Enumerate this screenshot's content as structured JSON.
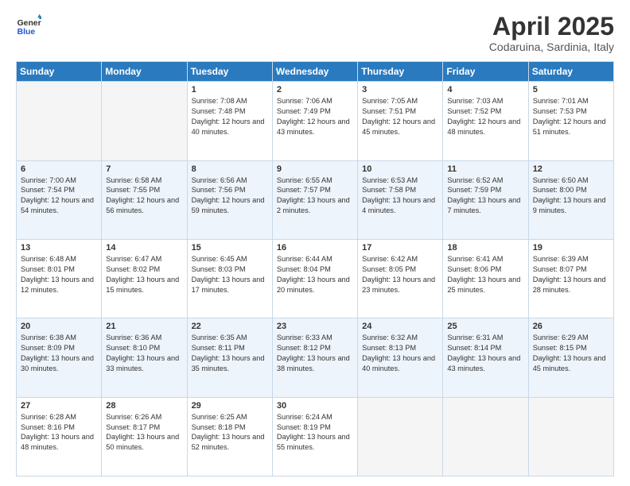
{
  "header": {
    "logo_general": "General",
    "logo_blue": "Blue",
    "month_title": "April 2025",
    "location": "Codaruina, Sardinia, Italy"
  },
  "weekdays": [
    "Sunday",
    "Monday",
    "Tuesday",
    "Wednesday",
    "Thursday",
    "Friday",
    "Saturday"
  ],
  "weeks": [
    [
      {
        "day": "",
        "empty": true
      },
      {
        "day": "",
        "empty": true
      },
      {
        "day": "1",
        "sunrise": "7:08 AM",
        "sunset": "7:48 PM",
        "daylight": "12 hours and 40 minutes."
      },
      {
        "day": "2",
        "sunrise": "7:06 AM",
        "sunset": "7:49 PM",
        "daylight": "12 hours and 43 minutes."
      },
      {
        "day": "3",
        "sunrise": "7:05 AM",
        "sunset": "7:51 PM",
        "daylight": "12 hours and 45 minutes."
      },
      {
        "day": "4",
        "sunrise": "7:03 AM",
        "sunset": "7:52 PM",
        "daylight": "12 hours and 48 minutes."
      },
      {
        "day": "5",
        "sunrise": "7:01 AM",
        "sunset": "7:53 PM",
        "daylight": "12 hours and 51 minutes."
      }
    ],
    [
      {
        "day": "6",
        "sunrise": "7:00 AM",
        "sunset": "7:54 PM",
        "daylight": "12 hours and 54 minutes."
      },
      {
        "day": "7",
        "sunrise": "6:58 AM",
        "sunset": "7:55 PM",
        "daylight": "12 hours and 56 minutes."
      },
      {
        "day": "8",
        "sunrise": "6:56 AM",
        "sunset": "7:56 PM",
        "daylight": "12 hours and 59 minutes."
      },
      {
        "day": "9",
        "sunrise": "6:55 AM",
        "sunset": "7:57 PM",
        "daylight": "13 hours and 2 minutes."
      },
      {
        "day": "10",
        "sunrise": "6:53 AM",
        "sunset": "7:58 PM",
        "daylight": "13 hours and 4 minutes."
      },
      {
        "day": "11",
        "sunrise": "6:52 AM",
        "sunset": "7:59 PM",
        "daylight": "13 hours and 7 minutes."
      },
      {
        "day": "12",
        "sunrise": "6:50 AM",
        "sunset": "8:00 PM",
        "daylight": "13 hours and 9 minutes."
      }
    ],
    [
      {
        "day": "13",
        "sunrise": "6:48 AM",
        "sunset": "8:01 PM",
        "daylight": "13 hours and 12 minutes."
      },
      {
        "day": "14",
        "sunrise": "6:47 AM",
        "sunset": "8:02 PM",
        "daylight": "13 hours and 15 minutes."
      },
      {
        "day": "15",
        "sunrise": "6:45 AM",
        "sunset": "8:03 PM",
        "daylight": "13 hours and 17 minutes."
      },
      {
        "day": "16",
        "sunrise": "6:44 AM",
        "sunset": "8:04 PM",
        "daylight": "13 hours and 20 minutes."
      },
      {
        "day": "17",
        "sunrise": "6:42 AM",
        "sunset": "8:05 PM",
        "daylight": "13 hours and 23 minutes."
      },
      {
        "day": "18",
        "sunrise": "6:41 AM",
        "sunset": "8:06 PM",
        "daylight": "13 hours and 25 minutes."
      },
      {
        "day": "19",
        "sunrise": "6:39 AM",
        "sunset": "8:07 PM",
        "daylight": "13 hours and 28 minutes."
      }
    ],
    [
      {
        "day": "20",
        "sunrise": "6:38 AM",
        "sunset": "8:09 PM",
        "daylight": "13 hours and 30 minutes."
      },
      {
        "day": "21",
        "sunrise": "6:36 AM",
        "sunset": "8:10 PM",
        "daylight": "13 hours and 33 minutes."
      },
      {
        "day": "22",
        "sunrise": "6:35 AM",
        "sunset": "8:11 PM",
        "daylight": "13 hours and 35 minutes."
      },
      {
        "day": "23",
        "sunrise": "6:33 AM",
        "sunset": "8:12 PM",
        "daylight": "13 hours and 38 minutes."
      },
      {
        "day": "24",
        "sunrise": "6:32 AM",
        "sunset": "8:13 PM",
        "daylight": "13 hours and 40 minutes."
      },
      {
        "day": "25",
        "sunrise": "6:31 AM",
        "sunset": "8:14 PM",
        "daylight": "13 hours and 43 minutes."
      },
      {
        "day": "26",
        "sunrise": "6:29 AM",
        "sunset": "8:15 PM",
        "daylight": "13 hours and 45 minutes."
      }
    ],
    [
      {
        "day": "27",
        "sunrise": "6:28 AM",
        "sunset": "8:16 PM",
        "daylight": "13 hours and 48 minutes."
      },
      {
        "day": "28",
        "sunrise": "6:26 AM",
        "sunset": "8:17 PM",
        "daylight": "13 hours and 50 minutes."
      },
      {
        "day": "29",
        "sunrise": "6:25 AM",
        "sunset": "8:18 PM",
        "daylight": "13 hours and 52 minutes."
      },
      {
        "day": "30",
        "sunrise": "6:24 AM",
        "sunset": "8:19 PM",
        "daylight": "13 hours and 55 minutes."
      },
      {
        "day": "",
        "empty": true
      },
      {
        "day": "",
        "empty": true
      },
      {
        "day": "",
        "empty": true
      }
    ]
  ]
}
